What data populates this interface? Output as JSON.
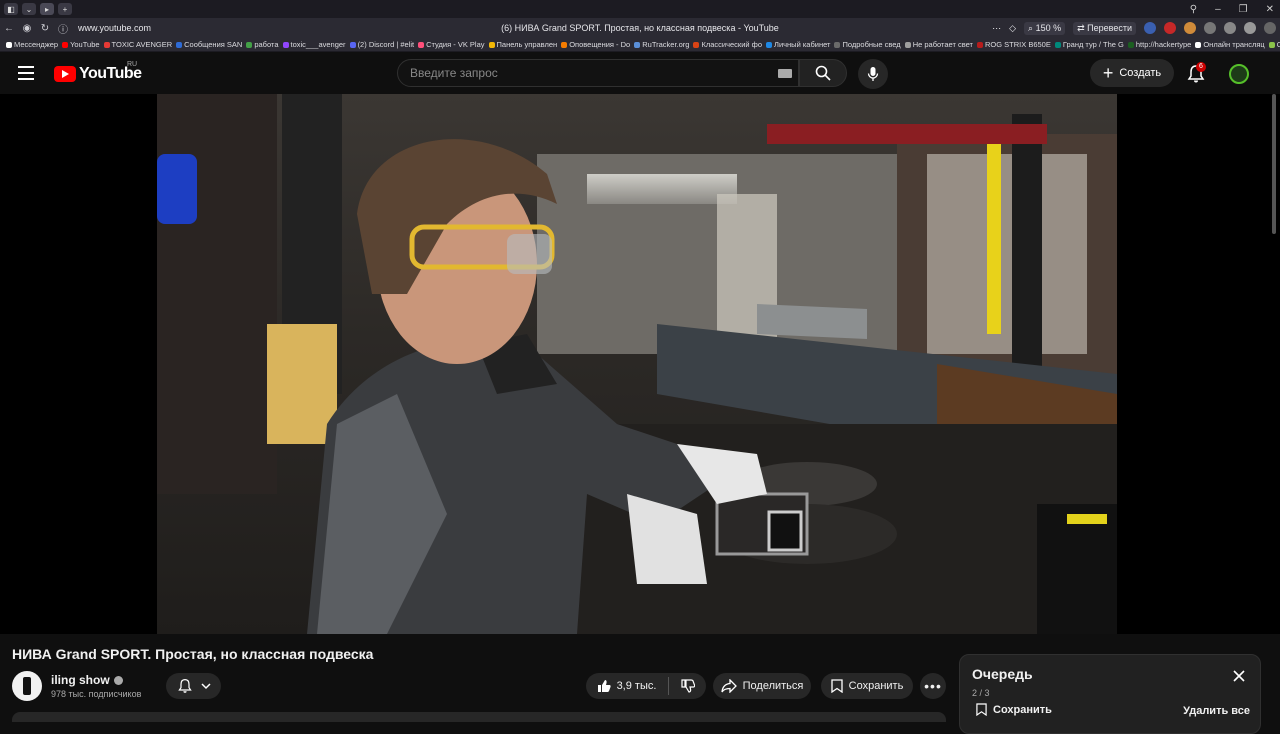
{
  "browser": {
    "window_title": "(6) НИВА Grand SPORT. Простая, но классная подвеска - YouTube",
    "url": "www.youtube.com",
    "zoom": "150 %",
    "translate_label": "Перевести",
    "bookmarks": [
      {
        "label": "Мессенджер",
        "color": "#ffffff"
      },
      {
        "label": "YouTube",
        "color": "#ff0000"
      },
      {
        "label": "TOXIC AVENGER",
        "color": "#e53935"
      },
      {
        "label": "Сообщения SAN",
        "color": "#2e6bd6"
      },
      {
        "label": "работа",
        "color": "#43a047"
      },
      {
        "label": "toxic___avenger",
        "color": "#9146ff"
      },
      {
        "label": "(2) Discord | #elit",
        "color": "#5865f2"
      },
      {
        "label": "Студия - VK Play",
        "color": "#ff4f7a"
      },
      {
        "label": "Панель управлен",
        "color": "#f2b705"
      },
      {
        "label": "Оповещения - Do",
        "color": "#f57c00"
      },
      {
        "label": "RuTracker.org",
        "color": "#5a8fd8"
      },
      {
        "label": "Классический фо",
        "color": "#d84315"
      },
      {
        "label": "Личный кабинет",
        "color": "#1e88e5"
      },
      {
        "label": "Подробные свед",
        "color": "#6a6a6a"
      },
      {
        "label": "Не работает свет",
        "color": "#9e9e9e"
      },
      {
        "label": "ROG STRIX B650E",
        "color": "#b71c1c"
      },
      {
        "label": "Гранд тур / The G",
        "color": "#00897b"
      },
      {
        "label": "http://hackertype",
        "color": "#1b5e20"
      },
      {
        "label": "Онлайн трансляц",
        "color": "#ffffff"
      },
      {
        "label": "Ор",
        "color": "#8bc34a"
      }
    ]
  },
  "header": {
    "logo_text": "YouTube",
    "country_code": "RU",
    "search_placeholder": "Введите запрос",
    "create_label": "Создать",
    "notification_count": "6"
  },
  "video": {
    "title": "НИВА Grand SPORT. Простая, но классная подвеска"
  },
  "channel": {
    "name": "iling show",
    "subscribers": "978 тыс. подписчиков"
  },
  "actions": {
    "likes": "3,9 тыс.",
    "share_label": "Поделиться",
    "save_label": "Сохранить"
  },
  "queue": {
    "title": "Очередь",
    "count": "2 / 3",
    "save_label": "Сохранить",
    "clear_label": "Удалить все"
  },
  "colors": {
    "brand_red": "#ff0000",
    "background": "#0f0f0f",
    "button_bg": "#272727"
  }
}
